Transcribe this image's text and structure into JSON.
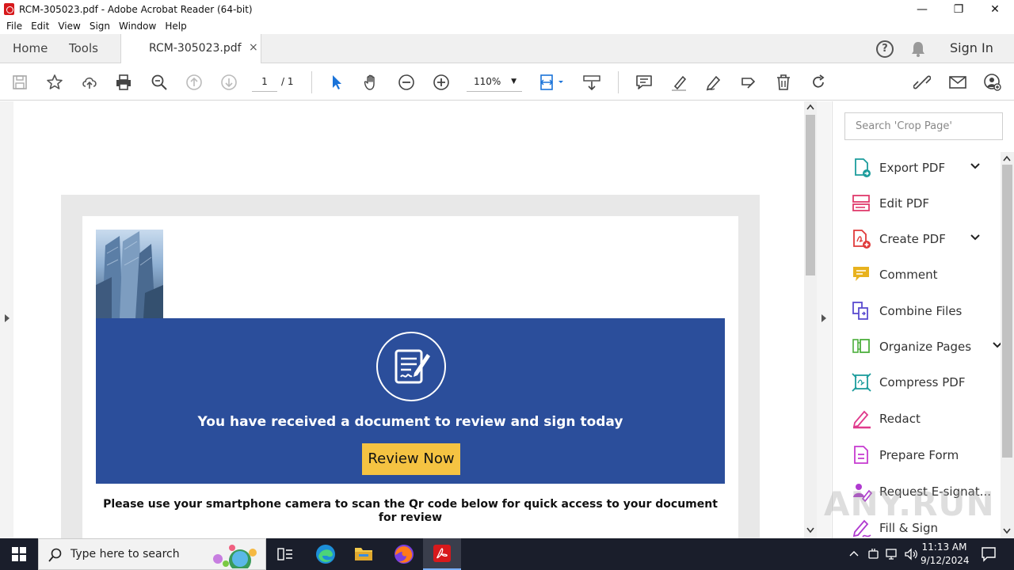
{
  "window": {
    "title": "RCM-305023.pdf - Adobe Acrobat Reader (64-bit)",
    "minimize": "—",
    "maximize": "❐",
    "close": "✕"
  },
  "menu": [
    "File",
    "Edit",
    "View",
    "Sign",
    "Window",
    "Help"
  ],
  "tabs": {
    "home": "Home",
    "tools": "Tools",
    "document": "RCM-305023.pdf",
    "close": "×",
    "sign_in": "Sign In"
  },
  "toolbar": {
    "page_current": "1",
    "page_total": "/ 1",
    "zoom": "110%",
    "zoom_arrow": "▼"
  },
  "tools_pane": {
    "search_placeholder": "Search 'Crop Page'",
    "items": [
      {
        "label": "Export PDF",
        "color": "#1c9c9c",
        "expandable": true
      },
      {
        "label": "Edit PDF",
        "color": "#e03a6c",
        "expandable": false
      },
      {
        "label": "Create PDF",
        "color": "#e03a3a",
        "expandable": true
      },
      {
        "label": "Comment",
        "color": "#e8b21e",
        "expandable": false
      },
      {
        "label": "Combine Files",
        "color": "#5a4bd0",
        "expandable": false
      },
      {
        "label": "Organize Pages",
        "color": "#4caf3c",
        "expandable": true
      },
      {
        "label": "Compress PDF",
        "color": "#1c9c9c",
        "expandable": false
      },
      {
        "label": "Redact",
        "color": "#e03a8c",
        "expandable": false
      },
      {
        "label": "Prepare Form",
        "color": "#c63ad0",
        "expandable": false
      },
      {
        "label": "Request E-signat...",
        "color": "#b03ad0",
        "expandable": false
      },
      {
        "label": "Fill & Sign",
        "color": "#b03ad0",
        "expandable": false
      }
    ],
    "chevron": "⌵"
  },
  "document": {
    "banner_title": "You have received a document to review and sign today",
    "button_label": "Review Now",
    "qr_instruction": "Please use your smartphone camera to scan the Qr code below for quick access to your document for review",
    "banner_color": "#2b4e9b",
    "button_color": "#f5c342"
  },
  "taskbar": {
    "search_placeholder": "Type here to search",
    "time": "11:13 AM",
    "date": "9/12/2024"
  },
  "watermark": "ANY.RUN"
}
